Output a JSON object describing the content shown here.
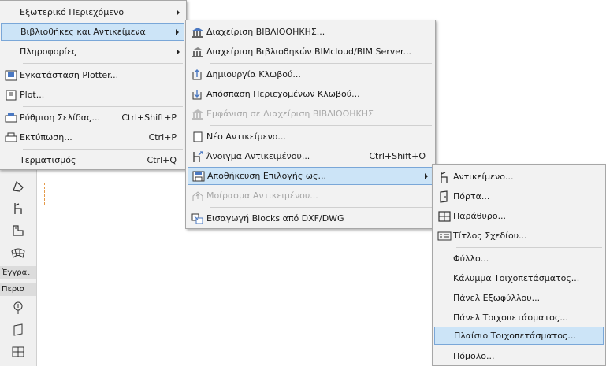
{
  "menu_main": {
    "items": [
      {
        "label": "Εξωτερικό Περιεχόμενο",
        "submenu": true
      },
      {
        "label": "Βιβλιοθήκες και Αντικείμενα",
        "submenu": true
      },
      {
        "label": "Πληροφορίες",
        "submenu": true
      },
      {
        "label": "Εγκατάσταση Plotter...",
        "icon": "plotter-icon"
      },
      {
        "label": "Plot...",
        "icon": "plot-icon"
      },
      {
        "label": "Ρύθμιση Σελίδας...",
        "shortcut": "Ctrl+Shift+P",
        "icon": "page-setup-icon"
      },
      {
        "label": "Εκτύπωση...",
        "shortcut": "Ctrl+P",
        "icon": "printer-icon"
      },
      {
        "label": "Τερματισμός",
        "shortcut": "Ctrl+Q"
      }
    ]
  },
  "menu_libraries": {
    "items": [
      {
        "label": "Διαχείριση ΒΙΒΛΙΟΘΗΚΗΣ...",
        "icon": "library-manager-icon"
      },
      {
        "label": "Διαχείριση Βιβλιοθηκών BIMcloud/BIM Server...",
        "icon": "bimcloud-library-icon"
      },
      {
        "label": "Δημιουργία Κλωβού...",
        "icon": "create-container-icon"
      },
      {
        "label": "Απόσπαση Περιεχομένων Κλωβού...",
        "icon": "extract-container-icon"
      },
      {
        "label": "Εμφάνιση σε Διαχείριση ΒΙΒΛΙΟΘΗΚΗΣ",
        "icon": "show-in-library-icon"
      },
      {
        "label": "Νέο Αντικείμενο...",
        "icon": "new-object-icon"
      },
      {
        "label": "Άνοιγμα Αντικειμένου...",
        "shortcut": "Ctrl+Shift+O",
        "icon": "open-object-icon"
      },
      {
        "label": "Αποθήκευση Επιλογής ως...",
        "icon": "save-selection-icon"
      },
      {
        "label": "Μοίρασμα Αντικειμένου...",
        "icon": "share-object-icon"
      },
      {
        "label": "Εισαγωγή Blocks από DXF/DWG",
        "icon": "import-blocks-icon"
      }
    ]
  },
  "menu_save_as": {
    "items": [
      {
        "label": "Αντικείμενο...",
        "icon": "object-chair-icon"
      },
      {
        "label": "Πόρτα...",
        "icon": "door-icon"
      },
      {
        "label": "Παράθυρο...",
        "icon": "window-icon"
      },
      {
        "label": "Τίτλος Σχεδίου...",
        "icon": "drawing-title-icon"
      },
      {
        "label": "Φύλλο..."
      },
      {
        "label": "Κάλυμμα Τοιχοπετάσματος..."
      },
      {
        "label": "Πάνελ Εξωφύλλου..."
      },
      {
        "label": "Πάνελ Τοιχοπετάσματος..."
      },
      {
        "label": "Πλαίσιο Τοιχοπετάσματος..."
      },
      {
        "label": "Πόμολο..."
      }
    ]
  },
  "toolbar": {
    "label_1": "Έγγραι",
    "label_2": "Περισ"
  },
  "colors": {
    "highlight": "#cce4f7",
    "highlight_border": "#7aa7d8",
    "menu_bg": "#f2f2f2",
    "disabled_text": "#a8a8a8"
  }
}
